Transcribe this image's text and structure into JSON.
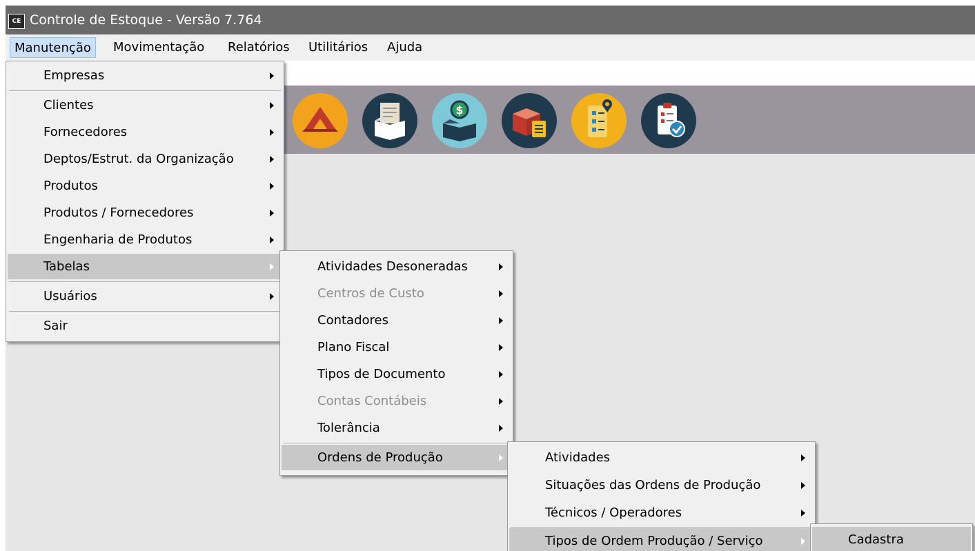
{
  "window": {
    "icon_text": "CE",
    "title": "Controle de Estoque - Versão 7.764"
  },
  "menubar": [
    {
      "label": "Manutenção"
    },
    {
      "label": "Movimentação"
    },
    {
      "label": "Relatórios"
    },
    {
      "label": "Utilitários"
    },
    {
      "label": "Ajuda"
    }
  ],
  "toolbar": {
    "icons": [
      "warehouse-icon",
      "document-box-icon",
      "money-box-icon",
      "inventory-box-icon",
      "checklist-location-icon",
      "clipboard-check-icon"
    ]
  },
  "menu_manutencao": [
    {
      "label": "Empresas"
    },
    {
      "label": "Clientes"
    },
    {
      "label": "Fornecedores"
    },
    {
      "label": "Deptos/Estrut. da Organização"
    },
    {
      "label": "Produtos"
    },
    {
      "label": "Produtos / Fornecedores"
    },
    {
      "label": "Engenharia de Produtos"
    },
    {
      "label": "Tabelas"
    },
    {
      "label": "Usuários"
    },
    {
      "label": "Sair"
    }
  ],
  "menu_tabelas": [
    {
      "label": "Atividades Desoneradas"
    },
    {
      "label": "Centros de Custo"
    },
    {
      "label": "Contadores"
    },
    {
      "label": "Plano Fiscal"
    },
    {
      "label": "Tipos de Documento"
    },
    {
      "label": "Contas Contábeis"
    },
    {
      "label": "Tolerância"
    },
    {
      "label": "Ordens de Produção"
    }
  ],
  "menu_ordens": [
    {
      "label": "Atividades"
    },
    {
      "label": "Situações das Ordens de Produção"
    },
    {
      "label": "Técnicos / Operadores"
    },
    {
      "label": "Tipos de Ordem Produção / Serviço"
    }
  ],
  "menu_tipos": [
    {
      "label": "Cadastra"
    }
  ]
}
